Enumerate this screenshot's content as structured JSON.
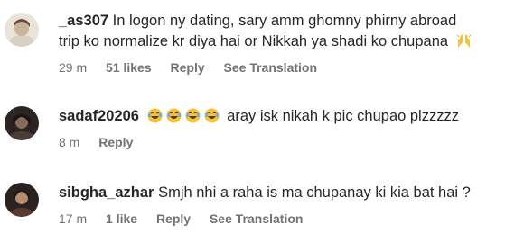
{
  "comments": [
    {
      "username": "_as307",
      "text_line1": "In logon ny dating, sary amm ghomny phirny abroad",
      "text_line2": "trip ko normalize kr diya hai or Nikkah ya shadi ko chupana",
      "time": "29 m",
      "likes": "51 likes",
      "reply": "Reply",
      "translate": "See Translation",
      "trailing_emoji": "raising-hands-emoji"
    },
    {
      "username": "sadaf20206",
      "text": "aray isk nikah k pic chupao plzzzzz",
      "time": "8 m",
      "reply": "Reply",
      "emojis": [
        "laughing-tears-emoji",
        "laughing-tears-emoji",
        "laughing-tears-emoji",
        "laughing-tears-emoji"
      ]
    },
    {
      "username": "sibgha_azhar",
      "text": "Smjh nhi a raha is ma chupanay ki kia bat hai ?",
      "time": "17 m",
      "likes": "1 like",
      "reply": "Reply",
      "translate": "See Translation"
    }
  ],
  "colors": {
    "text": "#262626",
    "meta": "#737373",
    "background": "#ffffff"
  }
}
